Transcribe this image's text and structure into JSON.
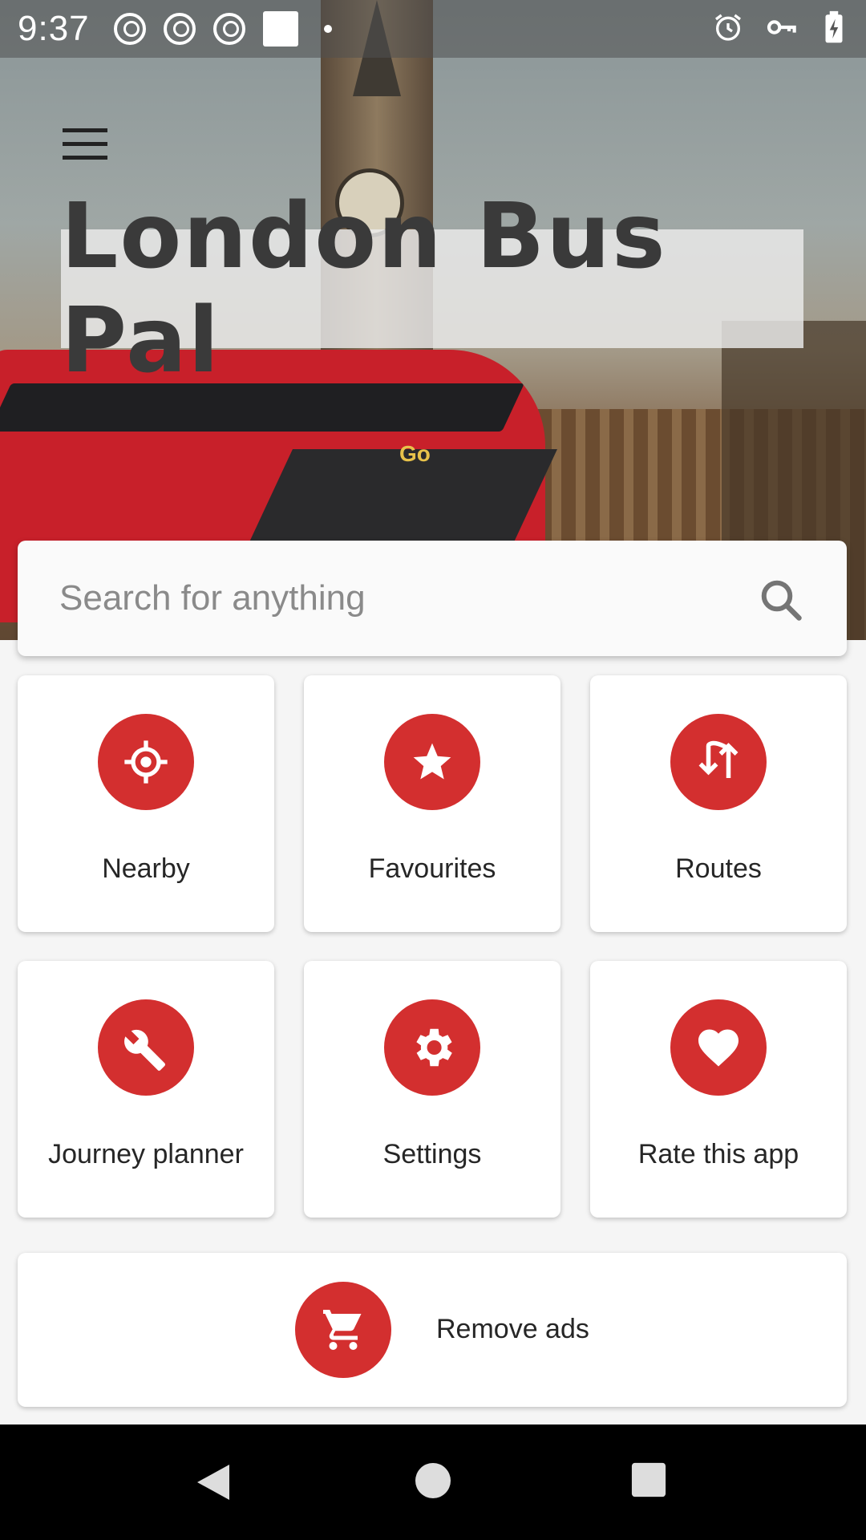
{
  "status_bar": {
    "time": "9:37"
  },
  "header": {
    "app_title": "London Bus Pal"
  },
  "search": {
    "placeholder": "Search for anything"
  },
  "tiles": [
    {
      "label": "Nearby",
      "icon": "crosshair-location-icon"
    },
    {
      "label": "Favourites",
      "icon": "star-icon"
    },
    {
      "label": "Routes",
      "icon": "swap-vertical-arrows-icon"
    },
    {
      "label": "Journey planner",
      "icon": "wrench-icon"
    },
    {
      "label": "Settings",
      "icon": "gear-icon"
    },
    {
      "label": "Rate this app",
      "icon": "heart-icon"
    }
  ],
  "remove_ads": {
    "label": "Remove ads",
    "icon": "cart-icon"
  },
  "colors": {
    "accent": "#d32f2f",
    "background": "#f5f5f5",
    "card": "#ffffff"
  }
}
